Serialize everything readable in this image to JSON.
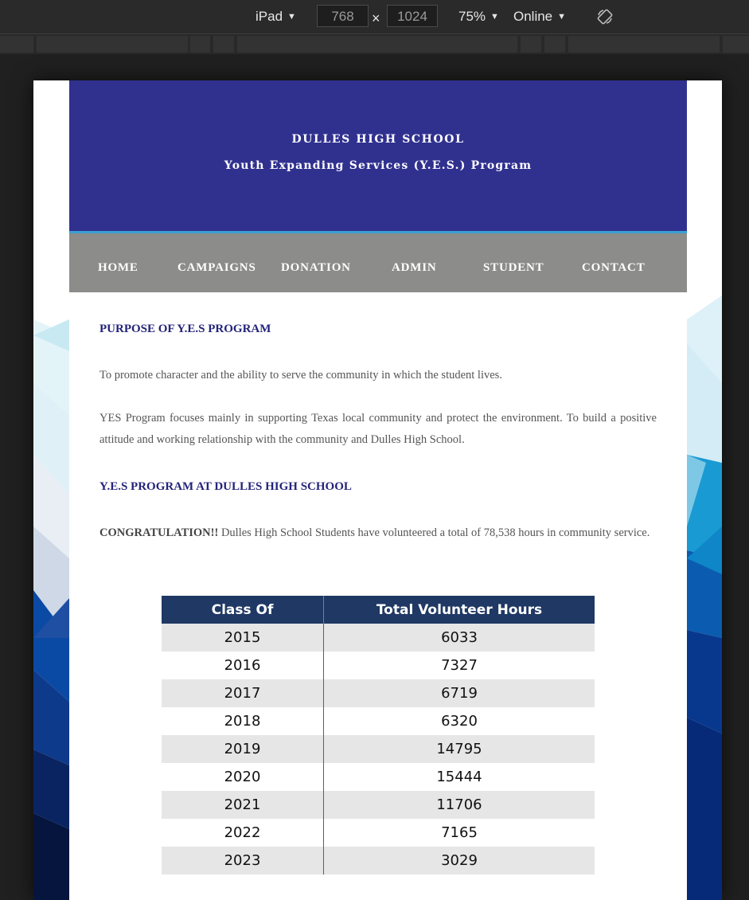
{
  "devtools": {
    "device": "iPad",
    "width": "768",
    "height": "1024",
    "zoom": "75%",
    "network": "Online",
    "times": "×"
  },
  "site": {
    "title": "DULLES HIGH SCHOOL",
    "subtitle": "Youth Expanding Services (Y.E.S.) Program"
  },
  "nav": {
    "items": [
      "HOME",
      "CAMPAIGNS",
      "DONATION",
      "ADMIN",
      "STUDENT",
      "CONTACT"
    ]
  },
  "content": {
    "purpose_heading": "PURPOSE OF Y.E.S PROGRAM",
    "purpose_p1": "To promote character and the ability to serve the community in which the student lives.",
    "purpose_p2": "YES Program focuses mainly in supporting Texas local community and protect the environment. To build a positive attitude and working relationship with the community and Dulles High School.",
    "program_heading": "Y.E.S PROGRAM AT DULLES HIGH SCHOOL",
    "congrats_bold": "CONGRATULATION!!",
    "congrats_text": " Dulles High School Students have volunteered a total of 78,538 hours in community service."
  },
  "table": {
    "headers": [
      "Class Of",
      "Total Volunteer Hours"
    ],
    "rows": [
      [
        "2015",
        "6033"
      ],
      [
        "2016",
        "7327"
      ],
      [
        "2017",
        "6719"
      ],
      [
        "2018",
        "6320"
      ],
      [
        "2019",
        "14795"
      ],
      [
        "2020",
        "15444"
      ],
      [
        "2021",
        "11706"
      ],
      [
        "2022",
        "7165"
      ],
      [
        "2023",
        "3029"
      ]
    ]
  },
  "colors": {
    "header_bg": "#30318f",
    "nav_bg": "#8c8c8a",
    "heading": "#23237a",
    "table_header": "#1f3864"
  }
}
